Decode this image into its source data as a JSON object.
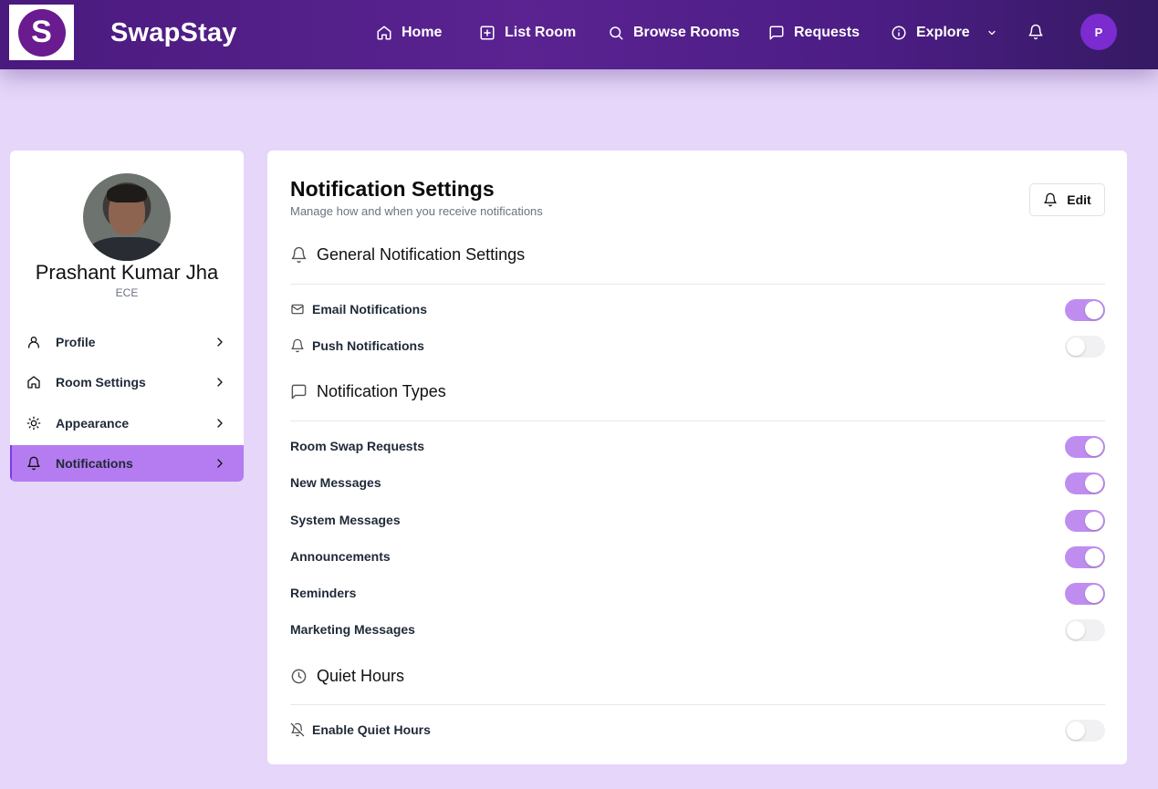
{
  "header": {
    "logo_letter": "S",
    "brand": "SwapStay",
    "nav": [
      {
        "label": "Home",
        "icon": "home-icon"
      },
      {
        "label": "List Room",
        "icon": "plus-square-icon"
      },
      {
        "label": "Browse Rooms",
        "icon": "search-icon"
      },
      {
        "label": "Requests",
        "icon": "message-square-icon"
      },
      {
        "label": "Explore",
        "icon": "info-icon"
      }
    ],
    "avatar_initial": "P"
  },
  "sidebar": {
    "name": "Prashant Kumar Jha",
    "dept": "ECE",
    "items": [
      {
        "label": "Profile",
        "icon": "user-icon",
        "active": false
      },
      {
        "label": "Room Settings",
        "icon": "home-icon",
        "active": false
      },
      {
        "label": "Appearance",
        "icon": "sun-icon",
        "active": false
      },
      {
        "label": "Notifications",
        "icon": "bell-icon",
        "active": true
      }
    ]
  },
  "main": {
    "title": "Notification Settings",
    "subtitle": "Manage how and when you receive notifications",
    "edit_label": "Edit",
    "sections": {
      "general": {
        "title": "General Notification Settings",
        "rows": [
          {
            "label": "Email Notifications",
            "icon": "mail-icon",
            "on": true
          },
          {
            "label": "Push Notifications",
            "icon": "bell-icon",
            "on": false
          }
        ]
      },
      "types": {
        "title": "Notification Types",
        "rows": [
          {
            "label": "Room Swap Requests",
            "on": true
          },
          {
            "label": "New Messages",
            "on": true
          },
          {
            "label": "System Messages",
            "on": true
          },
          {
            "label": "Announcements",
            "on": true
          },
          {
            "label": "Reminders",
            "on": true
          },
          {
            "label": "Marketing Messages",
            "on": false
          }
        ]
      },
      "quiet": {
        "title": "Quiet Hours",
        "rows": [
          {
            "label": "Enable Quiet Hours",
            "icon": "bell-off-icon",
            "on": false
          }
        ]
      }
    }
  },
  "colors": {
    "accent": "#bf8df0",
    "active_menu": "#b57bf0",
    "header_start": "#4a1a7e",
    "page_bg": "#e6d6f9"
  }
}
